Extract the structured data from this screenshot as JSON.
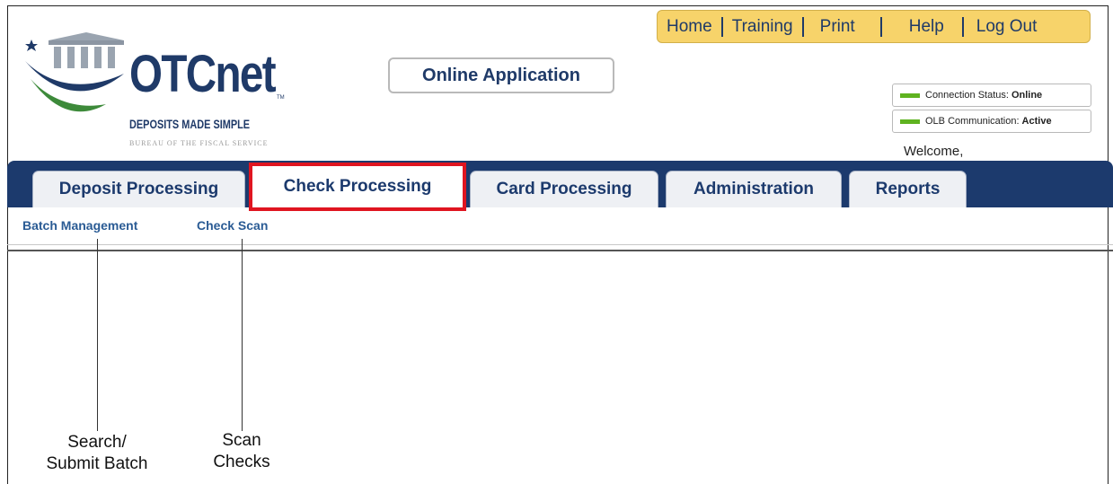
{
  "logo": {
    "wordmark": "OTCnet",
    "trademark": "TM",
    "tagline": "DEPOSITS MADE SIMPLE",
    "bureau": "BUREAU OF THE FISCAL SERVICE"
  },
  "app_label": "Online Application",
  "topnav": [
    "Home",
    "Training",
    "Print",
    "Help",
    "Log Out"
  ],
  "status": {
    "connection": {
      "label": "Connection Status:",
      "value": "Online"
    },
    "olb": {
      "label": "OLB Communication:",
      "value": "Active"
    }
  },
  "welcome": "Welcome,",
  "tabs": [
    "Deposit Processing",
    "Check Processing",
    "Card Processing",
    "Administration",
    "Reports"
  ],
  "active_tab": "Check Processing",
  "subnav": [
    "Batch Management",
    "Check Scan"
  ],
  "callouts": {
    "batch": [
      "Search/",
      "Submit Batch"
    ],
    "scan": [
      "Scan",
      "Checks"
    ]
  },
  "colors": {
    "navy": "#1c3a6d",
    "accent_yellow": "#f7d36a",
    "highlight_red": "#e01520",
    "status_green": "#5fb320",
    "link_blue": "#2a5b94"
  }
}
